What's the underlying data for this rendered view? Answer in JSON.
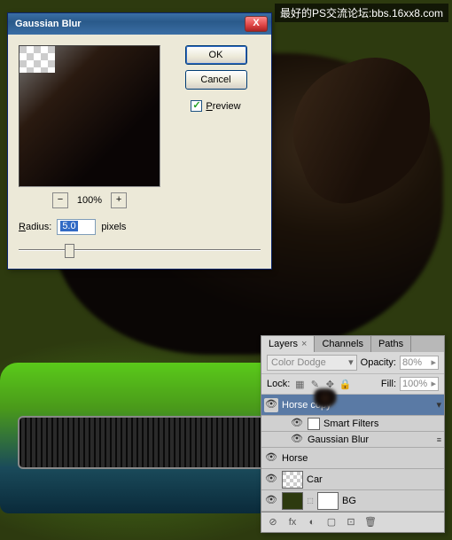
{
  "watermark": "最好的PS交流论坛:bbs.16xx8.com",
  "dialog": {
    "title": "Gaussian Blur",
    "ok": "OK",
    "cancel": "Cancel",
    "preview_label": "Preview",
    "preview_checked": true,
    "zoom_out": "−",
    "zoom_pct": "100%",
    "zoom_in": "+",
    "radius_label": "Radius:",
    "radius_value": "5.0",
    "radius_unit": "pixels",
    "close_glyph": "X"
  },
  "palette": {
    "tabs": [
      "Layers",
      "Channels",
      "Paths"
    ],
    "active_tab": 0,
    "blend_mode": "Color Dodge",
    "opacity_label": "Opacity:",
    "opacity_value": "80%",
    "lock_label": "Lock:",
    "fill_label": "Fill:",
    "fill_value": "100%",
    "layers": [
      {
        "name": "Horse copy",
        "selected": true
      },
      {
        "name": "Smart Filters",
        "sub": true
      },
      {
        "name": "Gaussian Blur",
        "sub": true
      },
      {
        "name": "Horse"
      },
      {
        "name": "Car"
      },
      {
        "name": "BG"
      }
    ],
    "footer_icons": [
      "⊘",
      "fx",
      "◐",
      "▢",
      "⊡",
      "🗑"
    ]
  }
}
